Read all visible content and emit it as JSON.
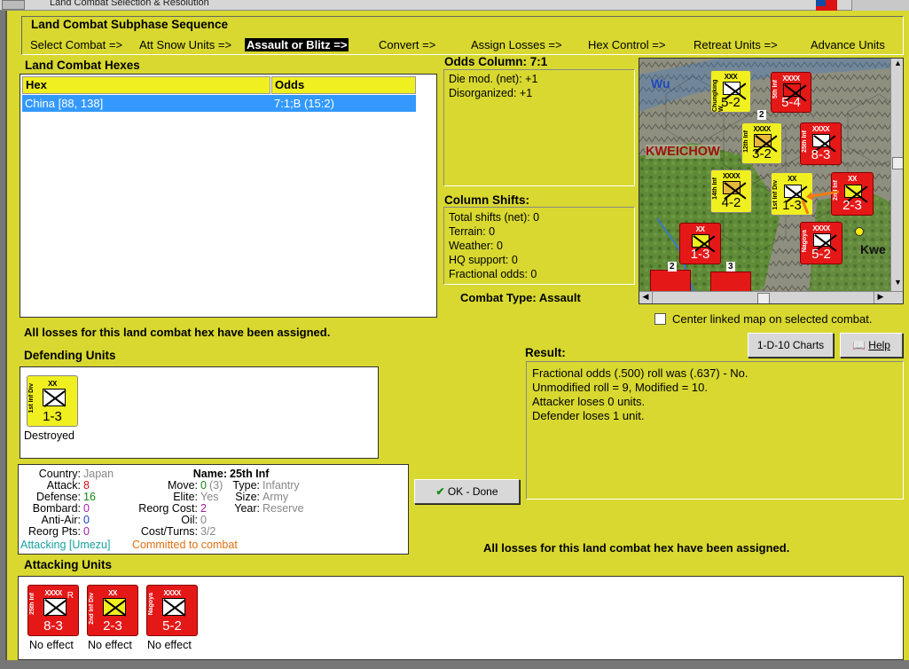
{
  "window": {
    "title": "Land Combat Selection & Resolution"
  },
  "sequence": {
    "title": "Land Combat Subphase Sequence",
    "phases": [
      {
        "label": "Select Combat =>"
      },
      {
        "label": "Att Snow Units =>"
      },
      {
        "label": "Assault or Blitz =>"
      },
      {
        "label": "Convert =>"
      },
      {
        "label": "Assign Losses =>"
      },
      {
        "label": "Hex Control =>"
      },
      {
        "label": "Retreat Units =>"
      },
      {
        "label": "Advance Units"
      }
    ]
  },
  "hexes": {
    "title": "Land Combat Hexes",
    "columns": [
      "Hex",
      "Odds"
    ],
    "rows": [
      {
        "hex": "China [88, 138]",
        "odds": "7:1;B (15:2)"
      }
    ]
  },
  "odds": {
    "title": "Odds Column: 7:1",
    "die_mod": "Die mod. (net): +1",
    "disorganized": "Disorganized: +1"
  },
  "shifts": {
    "title": "Column Shifts:",
    "items": [
      "Total shifts (net): 0",
      "Terrain: 0",
      "Weather: 0",
      "HQ support: 0",
      "Fractional odds: 0"
    ]
  },
  "combat_type": "Combat Type:  Assault",
  "map": {
    "labels": {
      "region": "KWEICHOW",
      "wu": "Wu",
      "kwe": "Kwe"
    },
    "counters": [
      {
        "side": "Chungking W.",
        "size": "XXX",
        "value": "5-2",
        "color": "yellow"
      },
      {
        "side": "5th Inf",
        "size": "XXXX",
        "value": "5-4",
        "color": "red"
      },
      {
        "side": "12th Inf",
        "size": "XXXX",
        "value": "3-2",
        "color": "yellow"
      },
      {
        "side": "25th Inf",
        "size": "XXXX",
        "value": "8-3",
        "color": "red"
      },
      {
        "side": "14th Inf",
        "size": "XXXX",
        "value": "4-2",
        "color": "yellow"
      },
      {
        "side": "1st Inf Div",
        "size": "XX",
        "value": "1-3",
        "color": "yellow"
      },
      {
        "side": "2nd Inf",
        "size": "XX",
        "value": "2-3",
        "color": "red"
      },
      {
        "side": "",
        "size": "XX",
        "value": "1-3",
        "color": "red"
      },
      {
        "side": "Nagoya",
        "size": "XXXX",
        "value": "5-2",
        "color": "red"
      }
    ],
    "stack_numbers": [
      "2",
      "2",
      "3"
    ]
  },
  "center_linked": {
    "label": "Center linked map on selected combat.",
    "checked": false
  },
  "buttons": {
    "charts": "1-D-10 Charts",
    "help": "Help",
    "ok": "OK - Done"
  },
  "losses_msg": "All losses for this land combat hex have been assigned.",
  "losses_msg2": "All losses for this land combat hex have been assigned.",
  "defending": {
    "title": "Defending Units",
    "units": [
      {
        "side": "1st Inf Div",
        "size": "XX",
        "value": "1-3",
        "status": "Destroyed"
      }
    ]
  },
  "result": {
    "title": "Result:",
    "lines": [
      "Fractional odds (.500) roll was (.637)  - No.",
      "Unmodified roll = 9, Modified = 10.",
      "Attacker loses 0 units.",
      "Defender loses 1 unit."
    ]
  },
  "unit_info": {
    "country_label": "Country:",
    "country": "Japan",
    "attack_label": "Attack:",
    "attack": "8",
    "defense_label": "Defense:",
    "defense": "16",
    "bombard_label": "Bombard:",
    "bombard": "0",
    "antiair_label": "Anti-Air:",
    "antiair": "0",
    "reorg_label": "Reorg Pts:",
    "reorg": "0",
    "name_label": "Name:",
    "name": "25th Inf",
    "move_label": "Move:",
    "move": "0",
    "move_extra": "(3)",
    "elite_label": "Elite:",
    "elite": "Yes",
    "reorg_cost_label": "Reorg Cost:",
    "reorg_cost": "2",
    "oil_label": "Oil:",
    "oil": "0",
    "cost_label": "Cost/Turns:",
    "cost": "3/2",
    "type_label": "Type:",
    "type": "Infantry",
    "size_label": "Size:",
    "size": "Army",
    "year_label": "Year:",
    "year": "Reserve",
    "attacking": "Attacking [Umezu]",
    "committed": "Committed to combat"
  },
  "attacking": {
    "title": "Attacking Units",
    "units": [
      {
        "side": "25th Inf",
        "size": "XXXX",
        "value": "8-3",
        "status": "No effect"
      },
      {
        "side": "2nd Inf Div",
        "size": "XX",
        "value": "2-3",
        "status": "No effect"
      },
      {
        "side": "Nagoya",
        "size": "XXXX",
        "value": "5-2",
        "status": "No effect"
      }
    ]
  },
  "colors": {
    "panel": "#d8d830",
    "selection": "#3399ff",
    "counter_red": "#e51818",
    "counter_yellow": "#f0ef20"
  }
}
